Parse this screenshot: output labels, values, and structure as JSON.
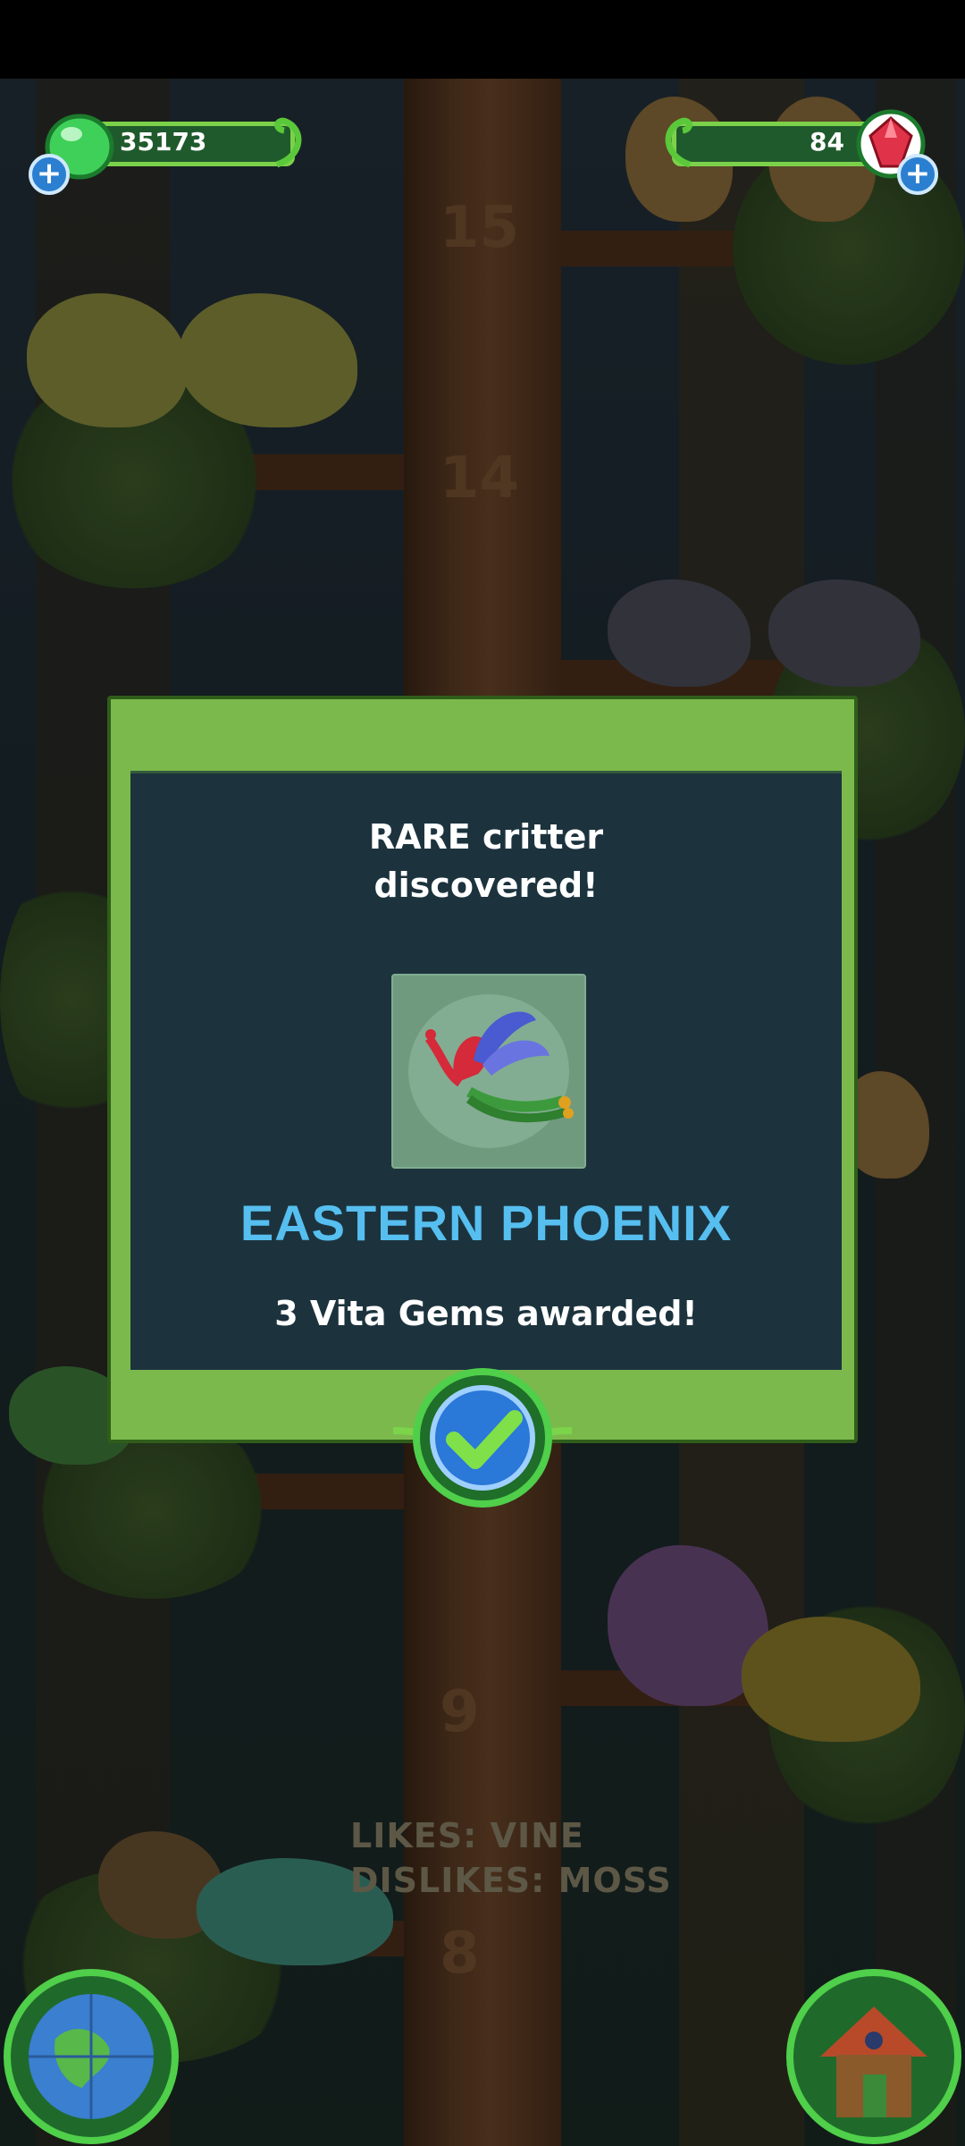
{
  "hud": {
    "vita_count": "35173",
    "gem_count": "84"
  },
  "trunk_numbers": [
    "15",
    "14",
    "9",
    "8"
  ],
  "critter_hint": {
    "likes": "LIKES: VINE",
    "dislikes": "DISLIKES: MOSS"
  },
  "dialog": {
    "title_line1": "RARE critter",
    "title_line2": "discovered!",
    "critter_name": "EASTERN PHOENIX",
    "reward": "3 Vita Gems awarded!",
    "confirm_icon": "checkmark-icon"
  },
  "colors": {
    "panel_green": "#7bb94d",
    "panel_dark": "#1c333e",
    "name_blue": "#56bff0",
    "hud_green": "#7cd14a"
  },
  "icons": [
    "vita-drop-icon",
    "gem-icon",
    "plus-icon",
    "globe-icon",
    "house-icon",
    "checkmark-icon"
  ]
}
